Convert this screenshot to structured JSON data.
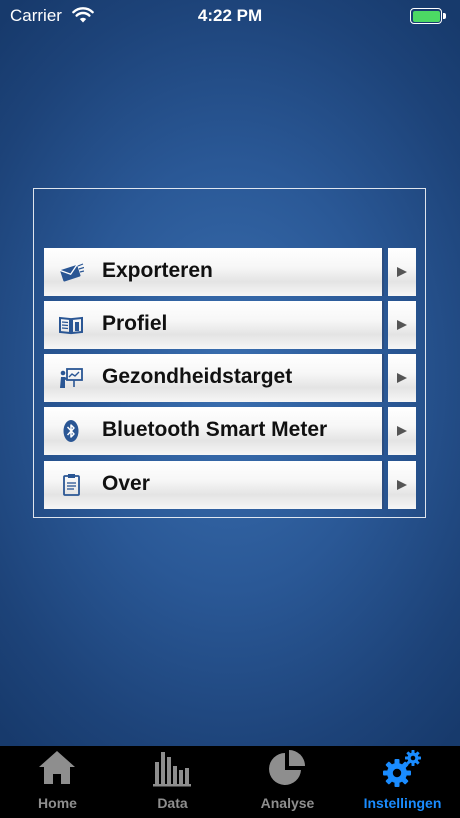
{
  "status_bar": {
    "carrier": "Carrier",
    "time": "4:22 PM",
    "battery_color": "#4cd964"
  },
  "menu": {
    "items": [
      {
        "label": "Exporteren",
        "icon": "envelope-send-icon"
      },
      {
        "label": "Profiel",
        "icon": "open-book-icon"
      },
      {
        "label": "Gezondheidstarget",
        "icon": "presentation-board-icon"
      },
      {
        "label": "Bluetooth Smart Meter",
        "icon": "bluetooth-icon"
      },
      {
        "label": "Over",
        "icon": "clipboard-icon"
      }
    ]
  },
  "tab_bar": {
    "tabs": [
      {
        "label": "Home",
        "icon": "home-icon",
        "active": false
      },
      {
        "label": "Data",
        "icon": "bar-chart-icon",
        "active": false
      },
      {
        "label": "Analyse",
        "icon": "pie-chart-icon",
        "active": false
      },
      {
        "label": "Instellingen",
        "icon": "gears-icon",
        "active": true
      }
    ],
    "active_color": "#1a8cff",
    "inactive_color": "#8e8e8e"
  }
}
